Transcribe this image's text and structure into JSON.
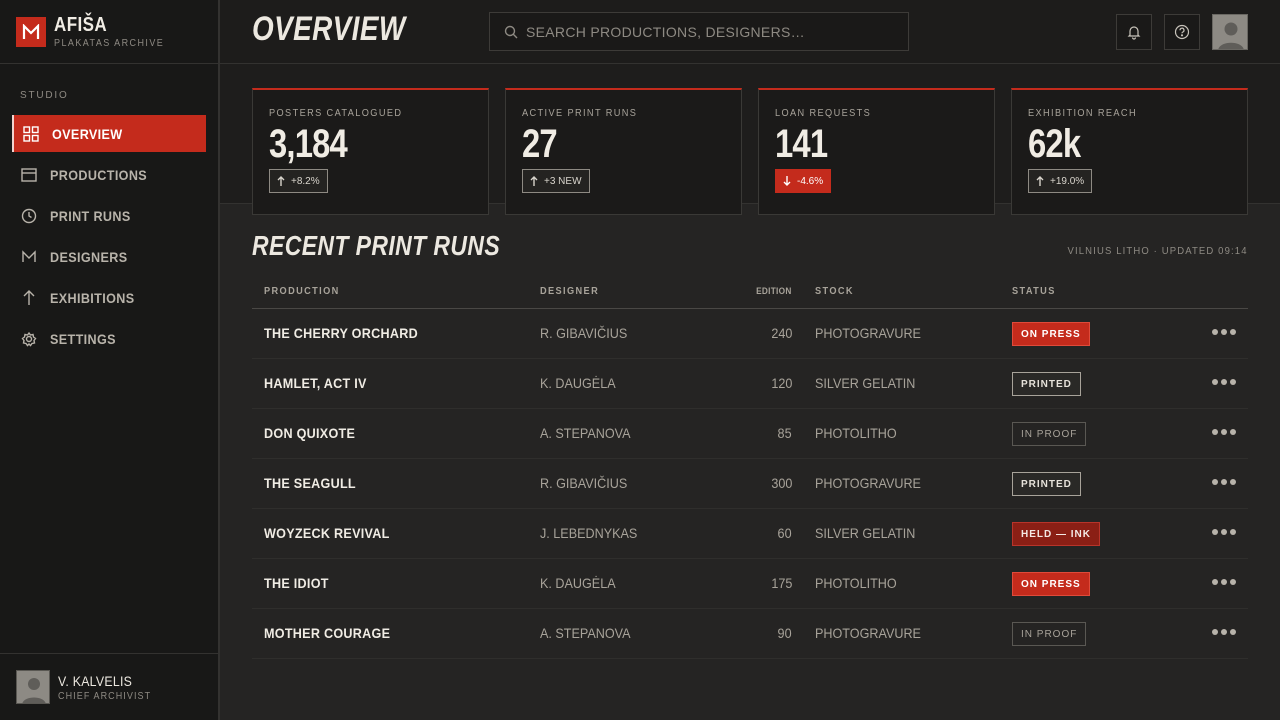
{
  "brand": {
    "name": "AFIŠA",
    "subtitle": "PLAKATAS ARCHIVE"
  },
  "sidebar": {
    "section": "STUDIO",
    "items": [
      {
        "label": "OVERVIEW",
        "icon": "grid-icon",
        "active": true
      },
      {
        "label": "PRODUCTIONS",
        "icon": "window-icon"
      },
      {
        "label": "PRINT RUNS",
        "icon": "clock-icon"
      },
      {
        "label": "DESIGNERS",
        "icon": "m-glyph-icon"
      },
      {
        "label": "EXHIBITIONS",
        "icon": "arrow-up-icon"
      },
      {
        "label": "SETTINGS",
        "icon": "gear-icon"
      }
    ],
    "user": {
      "name": "V. KALVELIS",
      "role": "CHIEF ARCHIVIST"
    }
  },
  "header": {
    "title": "OVERVIEW",
    "search_placeholder": "SEARCH PRODUCTIONS, DESIGNERS…"
  },
  "stats": [
    {
      "label": "POSTERS CATALOGUED",
      "value": "3,184",
      "delta": "+8.2%",
      "direction": "up"
    },
    {
      "label": "ACTIVE PRINT RUNS",
      "value": "27",
      "delta": "+3 NEW",
      "direction": "up"
    },
    {
      "label": "LOAN REQUESTS",
      "value": "141",
      "delta": "-4.6%",
      "direction": "down"
    },
    {
      "label": "EXHIBITION REACH",
      "value": "62k",
      "delta": "+19.0%",
      "direction": "up"
    }
  ],
  "recent": {
    "title": "RECENT PRINT RUNS",
    "meta": "VILNIUS LITHO · UPDATED 09:14",
    "columns": [
      "PRODUCTION",
      "DESIGNER",
      "EDITION",
      "STOCK",
      "STATUS"
    ],
    "rows": [
      {
        "production": "THE CHERRY ORCHARD",
        "designer": "R. GIBAVIČIUS",
        "edition": "240",
        "stock": "PHOTOGRAVURE",
        "status": "ON PRESS",
        "kind": "red"
      },
      {
        "production": "HAMLET, ACT IV",
        "designer": "K. DAUGĖLA",
        "edition": "120",
        "stock": "SILVER GELATIN",
        "status": "PRINTED",
        "kind": "printed"
      },
      {
        "production": "DON QUIXOTE",
        "designer": "A. STEPANOVA",
        "edition": "85",
        "stock": "PHOTOLITHO",
        "status": "IN PROOF",
        "kind": "proof"
      },
      {
        "production": "THE SEAGULL",
        "designer": "R. GIBAVIČIUS",
        "edition": "300",
        "stock": "PHOTOGRAVURE",
        "status": "PRINTED",
        "kind": "printed"
      },
      {
        "production": "WOYZECK REVIVAL",
        "designer": "J. LEBEDNYKAS",
        "edition": "60",
        "stock": "SILVER GELATIN",
        "status": "HELD — INK",
        "kind": "held"
      },
      {
        "production": "THE IDIOT",
        "designer": "K. DAUGĖLA",
        "edition": "175",
        "stock": "PHOTOLITHO",
        "status": "ON PRESS",
        "kind": "red"
      },
      {
        "production": "MOTHER COURAGE",
        "designer": "A. STEPANOVA",
        "edition": "90",
        "stock": "PHOTOGRAVURE",
        "status": "IN PROOF",
        "kind": "proof"
      }
    ]
  },
  "colors": {
    "accent": "#c42b1c",
    "background": "#252423",
    "sidebar": "#181817"
  }
}
